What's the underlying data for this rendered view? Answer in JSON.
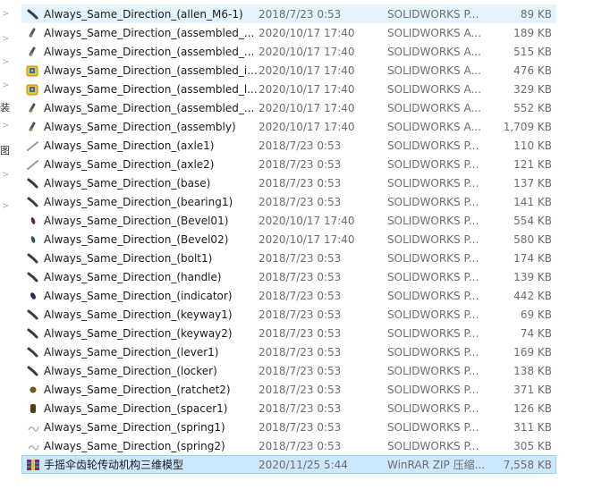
{
  "nav_strip": {
    "chevrons": [
      ">",
      ">",
      ">",
      ">",
      ">",
      ">",
      ">"
    ],
    "cjk_chars": [
      "装",
      "图"
    ]
  },
  "files": [
    {
      "name": "Always_Same_Direction_(allen_M6-1)",
      "date": "2018/7/23 0:53",
      "type": "SOLIDWORKS P...",
      "size": "89 KB",
      "icon": "part-icon"
    },
    {
      "name": "Always_Same_Direction_(assembled_...",
      "date": "2020/10/17 17:40",
      "type": "SOLIDWORKS A...",
      "size": "189 KB",
      "icon": "assembly-icon"
    },
    {
      "name": "Always_Same_Direction_(assembled_...",
      "date": "2020/10/17 17:40",
      "type": "SOLIDWORKS A...",
      "size": "515 KB",
      "icon": "assembly-icon"
    },
    {
      "name": "Always_Same_Direction_(assembled_i...",
      "date": "2020/10/17 17:40",
      "type": "SOLIDWORKS A...",
      "size": "476 KB",
      "icon": "solidworks-assembly-icon"
    },
    {
      "name": "Always_Same_Direction_(assembled_l...",
      "date": "2020/10/17 17:40",
      "type": "SOLIDWORKS A...",
      "size": "329 KB",
      "icon": "solidworks-assembly-icon"
    },
    {
      "name": "Always_Same_Direction_(assembled_...",
      "date": "2020/10/17 17:40",
      "type": "SOLIDWORKS A...",
      "size": "552 KB",
      "icon": "assembly-icon"
    },
    {
      "name": "Always_Same_Direction_(assembly)",
      "date": "2020/10/17 17:40",
      "type": "SOLIDWORKS A...",
      "size": "1,709 KB",
      "icon": "assembly-icon"
    },
    {
      "name": "Always_Same_Direction_(axle1)",
      "date": "2018/7/23 0:53",
      "type": "SOLIDWORKS P...",
      "size": "110 KB",
      "icon": "axle-part-icon"
    },
    {
      "name": "Always_Same_Direction_(axle2)",
      "date": "2018/7/23 0:53",
      "type": "SOLIDWORKS P...",
      "size": "121 KB",
      "icon": "axle-part-icon"
    },
    {
      "name": "Always_Same_Direction_(base)",
      "date": "2018/7/23 0:53",
      "type": "SOLIDWORKS P...",
      "size": "137 KB",
      "icon": "part-icon"
    },
    {
      "name": "Always_Same_Direction_(bearing1)",
      "date": "2018/7/23 0:53",
      "type": "SOLIDWORKS P...",
      "size": "141 KB",
      "icon": "part-icon"
    },
    {
      "name": "Always_Same_Direction_(Bevel01)",
      "date": "2020/10/17 17:40",
      "type": "SOLIDWORKS P...",
      "size": "554 KB",
      "icon": "bevel-part-icon"
    },
    {
      "name": "Always_Same_Direction_(Bevel02)",
      "date": "2020/10/17 17:40",
      "type": "SOLIDWORKS P...",
      "size": "580 KB",
      "icon": "bevel-green-part-icon"
    },
    {
      "name": "Always_Same_Direction_(bolt1)",
      "date": "2018/7/23 0:53",
      "type": "SOLIDWORKS P...",
      "size": "174 KB",
      "icon": "part-icon"
    },
    {
      "name": "Always_Same_Direction_(handle)",
      "date": "2018/7/23 0:53",
      "type": "SOLIDWORKS P...",
      "size": "139 KB",
      "icon": "part-icon"
    },
    {
      "name": "Always_Same_Direction_(indicator)",
      "date": "2018/7/23 0:53",
      "type": "SOLIDWORKS P...",
      "size": "442 KB",
      "icon": "indicator-part-icon"
    },
    {
      "name": "Always_Same_Direction_(keyway1)",
      "date": "2018/7/23 0:53",
      "type": "SOLIDWORKS P...",
      "size": "69 KB",
      "icon": "part-icon"
    },
    {
      "name": "Always_Same_Direction_(keyway2)",
      "date": "2018/7/23 0:53",
      "type": "SOLIDWORKS P...",
      "size": "74 KB",
      "icon": "part-icon"
    },
    {
      "name": "Always_Same_Direction_(lever1)",
      "date": "2018/7/23 0:53",
      "type": "SOLIDWORKS P...",
      "size": "169 KB",
      "icon": "part-icon"
    },
    {
      "name": "Always_Same_Direction_(locker)",
      "date": "2018/7/23 0:53",
      "type": "SOLIDWORKS P...",
      "size": "138 KB",
      "icon": "part-icon"
    },
    {
      "name": "Always_Same_Direction_(ratchet2)",
      "date": "2018/7/23 0:53",
      "type": "SOLIDWORKS P...",
      "size": "371 KB",
      "icon": "ratchet-part-icon"
    },
    {
      "name": "Always_Same_Direction_(spacer1)",
      "date": "2018/7/23 0:53",
      "type": "SOLIDWORKS P...",
      "size": "126 KB",
      "icon": "spacer-part-icon"
    },
    {
      "name": "Always_Same_Direction_(spring1)",
      "date": "2018/7/23 0:53",
      "type": "SOLIDWORKS P...",
      "size": "311 KB",
      "icon": "spring-part-icon"
    },
    {
      "name": "Always_Same_Direction_(spring2)",
      "date": "2018/7/23 0:53",
      "type": "SOLIDWORKS P...",
      "size": "305 KB",
      "icon": "spring-part-icon"
    },
    {
      "name": "手摇伞齿轮传动机构三维模型",
      "date": "2020/11/25 5:44",
      "type": "WinRAR ZIP 压缩...",
      "size": "7,558 KB",
      "icon": "winrar-archive-icon"
    }
  ],
  "hovered_row": 0,
  "selected_row": 24,
  "colors": {
    "hover": "#e5f3ff",
    "selected": "#cce8ff",
    "selected_border": "#99d1ff",
    "meta_text": "#6d6d6d"
  }
}
